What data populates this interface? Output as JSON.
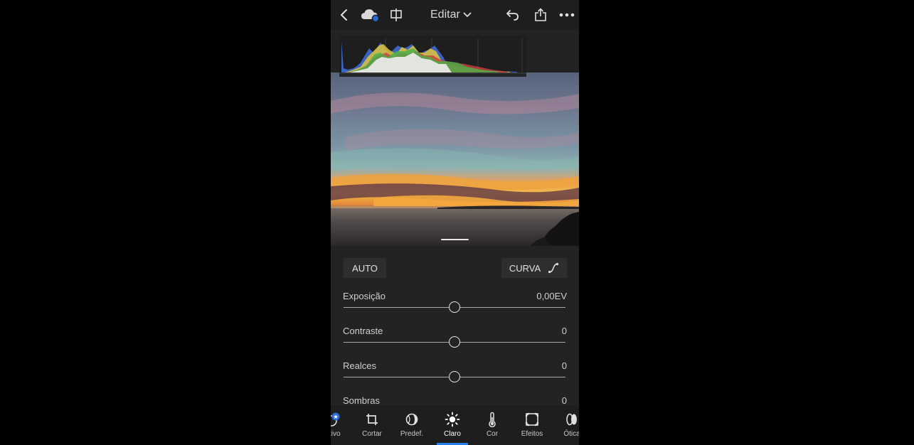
{
  "app": {
    "mode_label": "Editar"
  },
  "colors": {
    "accent": "#2680eb",
    "panel_bg": "#232323",
    "toolbar_bg": "#1e1e1e",
    "sync_dot": "#2f6bd6"
  },
  "topbar": {
    "icons": [
      "back-chevron-icon",
      "cloud-sync-icon",
      "compare-icon",
      "undo-icon",
      "share-icon",
      "more-icon"
    ]
  },
  "panel": {
    "auto_label": "AUTO",
    "curve_label": "CURVA",
    "sliders": [
      {
        "label": "Exposição",
        "value": "0,00EV",
        "position": 0.5
      },
      {
        "label": "Contraste",
        "value": "0",
        "position": 0.5
      },
      {
        "label": "Realces",
        "value": "0",
        "position": 0.5
      },
      {
        "label": "Sombras",
        "value": "0"
      }
    ]
  },
  "toolbar": {
    "tools": [
      {
        "label": "etivo",
        "icon": "selective-icon"
      },
      {
        "label": "Cortar",
        "icon": "crop-icon"
      },
      {
        "label": "Predef.",
        "icon": "presets-icon"
      },
      {
        "label": "Claro",
        "icon": "light-icon",
        "active": true
      },
      {
        "label": "Cor",
        "icon": "color-temperature-icon"
      },
      {
        "label": "Efeitos",
        "icon": "effects-icon"
      },
      {
        "label": "Ótica",
        "icon": "optics-icon"
      }
    ]
  }
}
